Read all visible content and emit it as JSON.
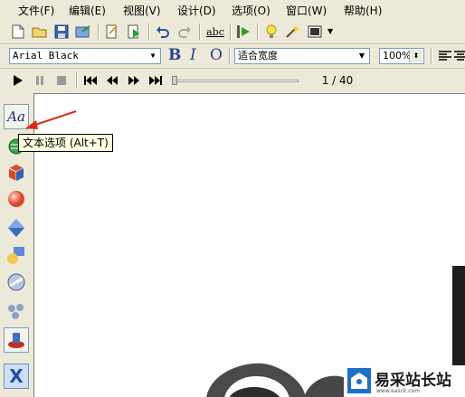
{
  "menu": {
    "items": [
      "文件(F)",
      "编辑(E)",
      "视图(V)",
      "设计(D)",
      "选项(O)",
      "窗口(W)",
      "帮助(H)"
    ]
  },
  "toolbar": {
    "spell_label": "abc"
  },
  "format": {
    "font_name": "Arial Black",
    "bold_label": "B",
    "italic_label": "I",
    "outline_label": "O",
    "width_mode": "适合宽度",
    "zoom": "100%"
  },
  "playback": {
    "page_indicator": "1 / 40"
  },
  "tools": {
    "text_tool_label": "Aa",
    "tooltip": "文本选项 (Alt+T)"
  },
  "watermark": {
    "brand": "易采站长站",
    "sub": "www.easck.com"
  },
  "colors": {
    "accent_red": "#d9261c",
    "brand_blue": "#1e6fc7"
  }
}
